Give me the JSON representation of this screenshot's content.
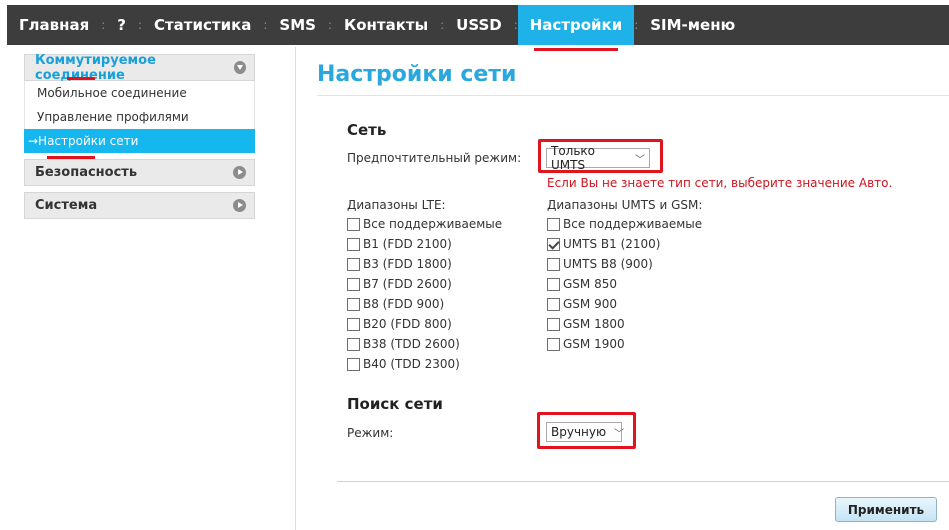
{
  "nav": {
    "items": [
      {
        "label": "Главная",
        "active": false
      },
      {
        "label": "?",
        "active": false
      },
      {
        "label": "Статистика",
        "active": false
      },
      {
        "label": "SMS",
        "active": false
      },
      {
        "label": "Контакты",
        "active": false
      },
      {
        "label": "USSD",
        "active": false
      },
      {
        "label": "Настройки",
        "active": true
      },
      {
        "label": "SIM-меню",
        "active": false
      }
    ],
    "separator": ":"
  },
  "sidebar": {
    "group_dialup": "Коммутируемое соединение",
    "sub_mobile": "Мобильное соединение",
    "sub_profiles": "Управление профилями",
    "sub_network": "→Настройки сети",
    "group_security": "Безопасность",
    "group_system": "Система"
  },
  "main": {
    "title": "Настройки сети",
    "network": {
      "section_title": "Сеть",
      "pref_mode_label": "Предпочтительный режим:",
      "pref_mode_value": "Только UMTS",
      "warning": "Если Вы не знаете тип сети, выберите значение Авто.",
      "lte_label": "Диапазоны LTE:",
      "umts_label": "Диапазоны UMTS и GSM:",
      "lte_bands": [
        {
          "label": "Все поддерживаемые",
          "checked": false
        },
        {
          "label": "B1 (FDD 2100)",
          "checked": false
        },
        {
          "label": "B3 (FDD 1800)",
          "checked": false
        },
        {
          "label": "B7 (FDD 2600)",
          "checked": false
        },
        {
          "label": "B8 (FDD 900)",
          "checked": false
        },
        {
          "label": "B20 (FDD 800)",
          "checked": false
        },
        {
          "label": "B38 (TDD 2600)",
          "checked": false
        },
        {
          "label": "B40 (TDD 2300)",
          "checked": false
        }
      ],
      "umts_bands": [
        {
          "label": "Все поддерживаемые",
          "checked": false
        },
        {
          "label": "UMTS B1 (2100)",
          "checked": true
        },
        {
          "label": "UMTS B8 (900)",
          "checked": false
        },
        {
          "label": "GSM 850",
          "checked": false
        },
        {
          "label": "GSM 900",
          "checked": false
        },
        {
          "label": "GSM 1800",
          "checked": false
        },
        {
          "label": "GSM 1900",
          "checked": false
        }
      ]
    },
    "search": {
      "section_title": "Поиск сети",
      "mode_label": "Режим:",
      "mode_value": "Вручную"
    },
    "apply_label": "Применить"
  },
  "colors": {
    "nav_bg": "#3d3d3d",
    "accent": "#1fb2e8",
    "title": "#2aa7dc",
    "highlight_red": "#e0141e"
  }
}
